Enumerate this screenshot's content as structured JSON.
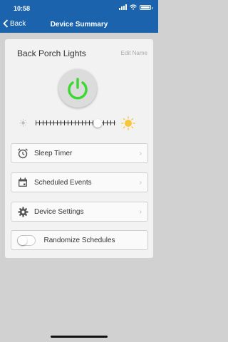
{
  "status_bar": {
    "time": "10:58"
  },
  "nav": {
    "back_label": "Back",
    "title": "Device Summary"
  },
  "device": {
    "name": "Back Porch Lights",
    "edit_label": "Edit Name",
    "power_color": "#3bd832"
  },
  "brightness": {
    "level": 0.78
  },
  "menu": {
    "sleep_timer": "Sleep Timer",
    "scheduled_events": "Scheduled Events",
    "device_settings": "Device Settings"
  },
  "randomize": {
    "label": "Randomize Schedules",
    "enabled": false
  },
  "colors": {
    "header": "#1b63ad",
    "background": "#d1d1d1",
    "sun": "#f6c73c"
  }
}
